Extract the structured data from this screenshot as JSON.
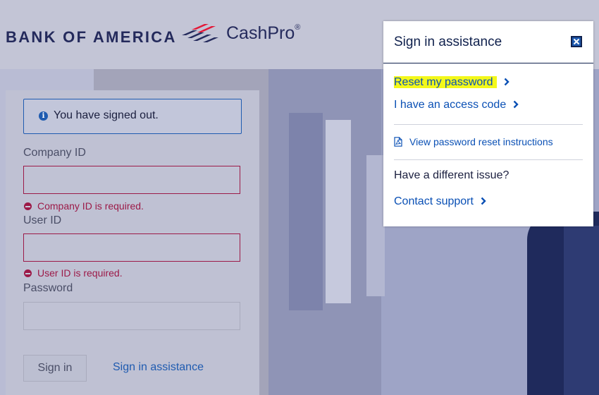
{
  "header": {
    "brand": "BANK OF AMERICA",
    "product": "CashPro",
    "product_mark": "®"
  },
  "signin_card": {
    "alert_text": "You have signed out.",
    "alert_icon": "info-icon",
    "company_id_label": "Company ID",
    "company_id_value": "",
    "company_id_error": "Company ID is required.",
    "user_id_label": "User ID",
    "user_id_value": "",
    "user_id_error": "User ID is required.",
    "password_label": "Password",
    "password_value": "",
    "signin_button": "Sign in",
    "assistance_link": "Sign in assistance"
  },
  "assist_popover": {
    "title": "Sign in assistance",
    "close_icon": "close-icon",
    "reset_password": "Reset my password",
    "access_code": "I have an access code",
    "pdf_link": "View password reset instructions",
    "different_issue": "Have a different issue?",
    "contact_support": "Contact support"
  },
  "colors": {
    "brand_navy": "#242a5c",
    "link_blue": "#0a50b5",
    "error_red": "#9c1a48",
    "brand_red": "#e31837",
    "highlight": "#f3f81a"
  }
}
